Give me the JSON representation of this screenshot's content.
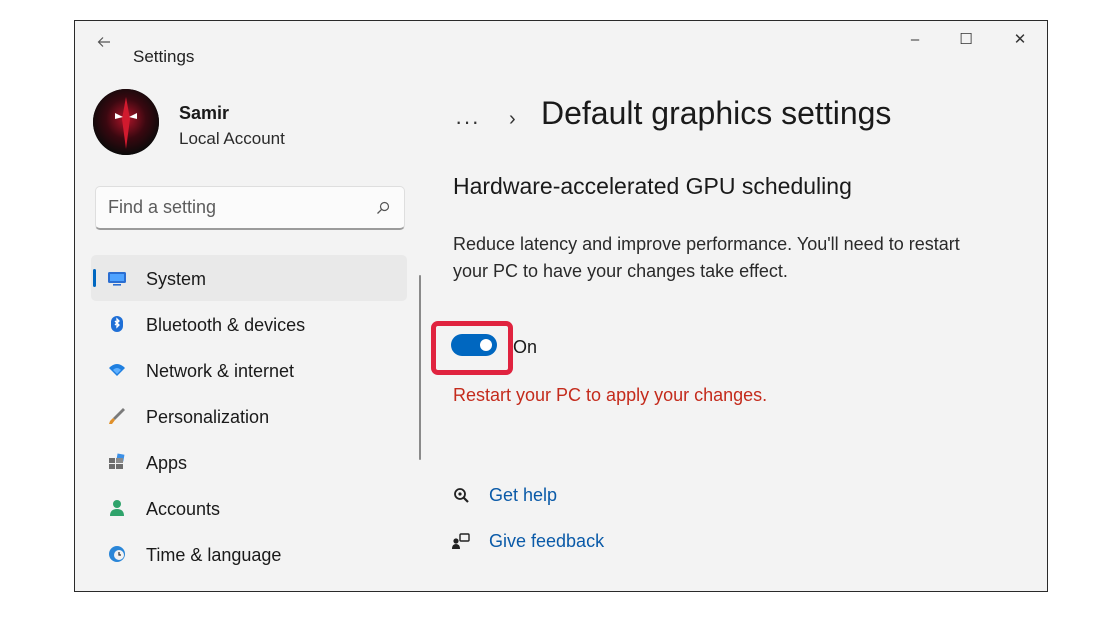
{
  "window": {
    "title": "Settings",
    "controls": {
      "minimize": "–",
      "maximize": "☐",
      "close": "✕"
    }
  },
  "profile": {
    "name": "Samir",
    "account_type": "Local Account"
  },
  "search": {
    "placeholder": "Find a setting"
  },
  "sidebar": {
    "items": [
      {
        "label": "System",
        "icon": "monitor-icon",
        "active": true
      },
      {
        "label": "Bluetooth & devices",
        "icon": "bluetooth-icon",
        "active": false
      },
      {
        "label": "Network & internet",
        "icon": "wifi-icon",
        "active": false
      },
      {
        "label": "Personalization",
        "icon": "brush-icon",
        "active": false
      },
      {
        "label": "Apps",
        "icon": "apps-icon",
        "active": false
      },
      {
        "label": "Accounts",
        "icon": "person-icon",
        "active": false
      },
      {
        "label": "Time & language",
        "icon": "globe-clock-icon",
        "active": false
      }
    ]
  },
  "breadcrumb": {
    "ellipsis": "···",
    "separator": "›",
    "title": "Default graphics settings"
  },
  "content": {
    "section_title": "Hardware-accelerated GPU scheduling",
    "description": "Reduce latency and improve performance. You'll need to restart your PC to have your changes take effect.",
    "toggle": {
      "state": "On",
      "checked": true
    },
    "warning": "Restart your PC to apply your changes."
  },
  "links": {
    "help": "Get help",
    "feedback": "Give feedback"
  },
  "colors": {
    "accent": "#0067c0",
    "warning": "#c42b1c",
    "highlight_box": "#e0233f"
  }
}
